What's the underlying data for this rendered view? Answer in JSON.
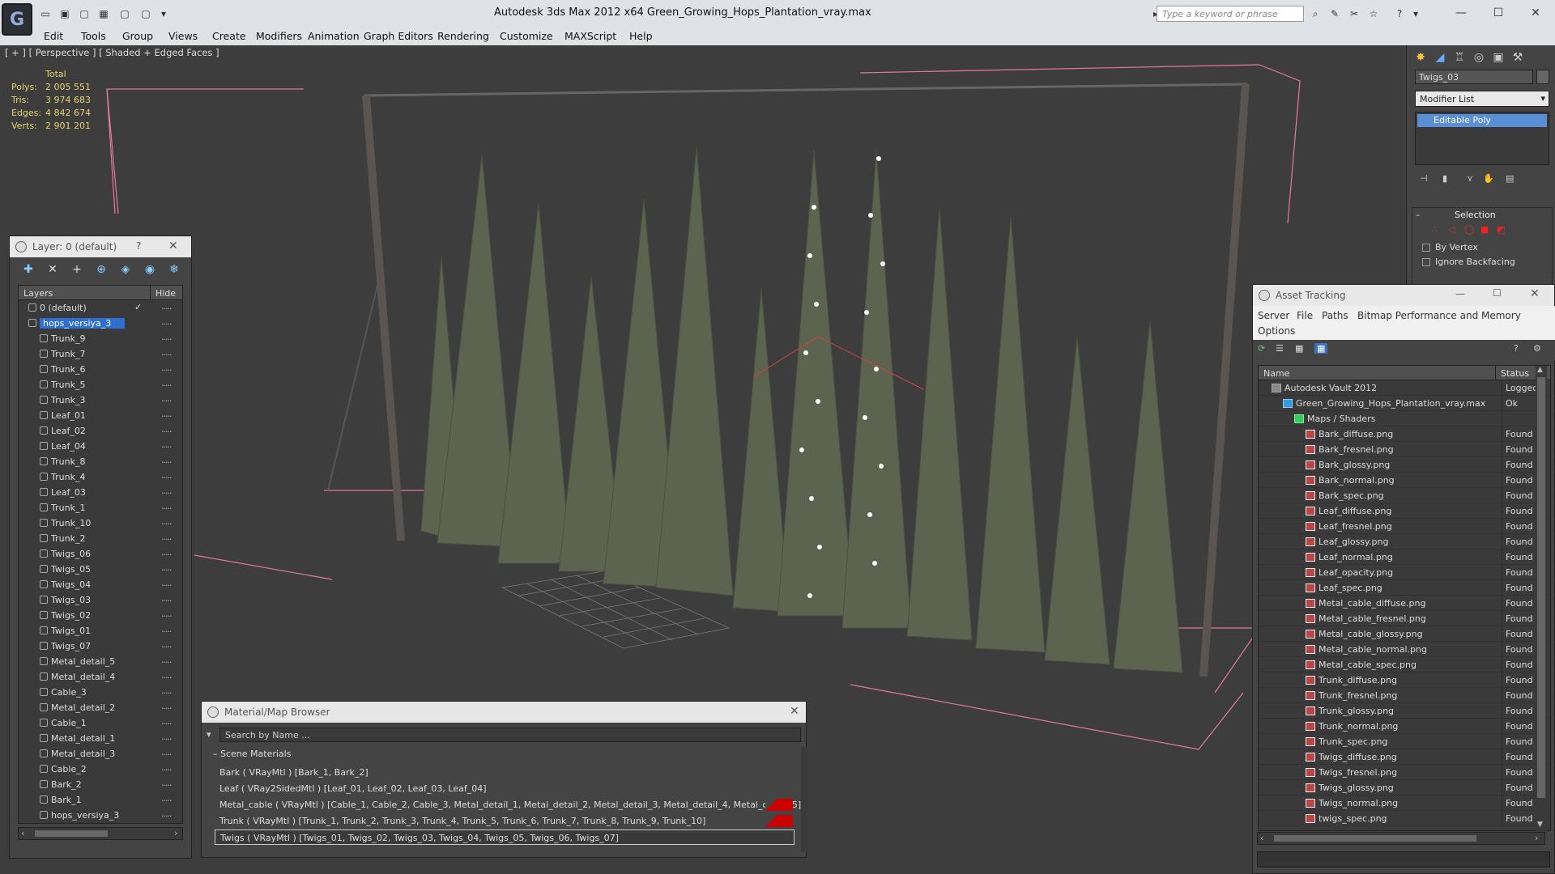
{
  "window": {
    "title": "Autodesk 3ds Max  2012 x64      Green_Growing_Hops_Plantation_vray.max",
    "search_placeholder": "Type a keyword or phrase"
  },
  "menu": [
    "Edit",
    "Tools",
    "Group",
    "Views",
    "Create",
    "Modifiers",
    "Animation",
    "Graph Editors",
    "Rendering",
    "Customize",
    "MAXScript",
    "Help"
  ],
  "viewport": {
    "label": "[ + ] [ Perspective ] [ Shaded + Edged Faces ]",
    "stats": {
      "header": "Total",
      "rows": [
        {
          "k": "Polys:",
          "v": "2 005 551"
        },
        {
          "k": "Tris:",
          "v": "3 974 683"
        },
        {
          "k": "Edges:",
          "v": "4 842 674"
        },
        {
          "k": "Verts:",
          "v": "2 901 201"
        }
      ]
    }
  },
  "layer_window": {
    "title": "Layer: 0 (default)",
    "help": "?",
    "col_layers": "Layers",
    "col_hide": "Hide",
    "layers": [
      {
        "name": "0 (default)",
        "level": 0,
        "check": true
      },
      {
        "name": "hops_versiya_3",
        "level": 0,
        "selected": true
      },
      {
        "name": "Trunk_9",
        "level": 1
      },
      {
        "name": "Trunk_7",
        "level": 1
      },
      {
        "name": "Trunk_6",
        "level": 1
      },
      {
        "name": "Trunk_5",
        "level": 1
      },
      {
        "name": "Trunk_3",
        "level": 1
      },
      {
        "name": "Leaf_01",
        "level": 1
      },
      {
        "name": "Leaf_02",
        "level": 1
      },
      {
        "name": "Leaf_04",
        "level": 1
      },
      {
        "name": "Trunk_8",
        "level": 1
      },
      {
        "name": "Trunk_4",
        "level": 1
      },
      {
        "name": "Leaf_03",
        "level": 1
      },
      {
        "name": "Trunk_1",
        "level": 1
      },
      {
        "name": "Trunk_10",
        "level": 1
      },
      {
        "name": "Trunk_2",
        "level": 1
      },
      {
        "name": "Twigs_06",
        "level": 1
      },
      {
        "name": "Twigs_05",
        "level": 1
      },
      {
        "name": "Twigs_04",
        "level": 1
      },
      {
        "name": "Twigs_03",
        "level": 1
      },
      {
        "name": "Twigs_02",
        "level": 1
      },
      {
        "name": "Twigs_01",
        "level": 1
      },
      {
        "name": "Twigs_07",
        "level": 1
      },
      {
        "name": "Metal_detail_5",
        "level": 1
      },
      {
        "name": "Metal_detail_4",
        "level": 1
      },
      {
        "name": "Cable_3",
        "level": 1
      },
      {
        "name": "Metal_detail_2",
        "level": 1
      },
      {
        "name": "Cable_1",
        "level": 1
      },
      {
        "name": "Metal_detail_1",
        "level": 1
      },
      {
        "name": "Metal_detail_3",
        "level": 1
      },
      {
        "name": "Cable_2",
        "level": 1
      },
      {
        "name": "Bark_2",
        "level": 1
      },
      {
        "name": "Bark_1",
        "level": 1
      },
      {
        "name": "hops_versiya_3",
        "level": 1
      }
    ]
  },
  "command_panel": {
    "object_name": "Twigs_03",
    "modifier_list": "Modifier List",
    "modifier_stack": [
      "Editable Poly"
    ],
    "selection_title": "Selection",
    "by_vertex": "By Vertex",
    "ignore_backfacing": "Ignore Backfacing"
  },
  "asset_tracking": {
    "title": "Asset Tracking",
    "menu": [
      "Server",
      "File",
      "Paths",
      "Bitmap Performance and Memory",
      "Options"
    ],
    "col_name": "Name",
    "col_status": "Status",
    "rows": [
      {
        "name": "Autodesk Vault 2012",
        "status": "Logged",
        "level": 0,
        "kind": "vault"
      },
      {
        "name": "Green_Growing_Hops_Plantation_vray.max",
        "status": "Ok",
        "level": 1,
        "kind": "max"
      },
      {
        "name": "Maps / Shaders",
        "status": "",
        "level": 2,
        "kind": "folder"
      },
      {
        "name": "Bark_diffuse.png",
        "status": "Found",
        "level": 3,
        "kind": "png"
      },
      {
        "name": "Bark_fresnel.png",
        "status": "Found",
        "level": 3,
        "kind": "png"
      },
      {
        "name": "Bark_glossy.png",
        "status": "Found",
        "level": 3,
        "kind": "png"
      },
      {
        "name": "Bark_normal.png",
        "status": "Found",
        "level": 3,
        "kind": "png"
      },
      {
        "name": "Bark_spec.png",
        "status": "Found",
        "level": 3,
        "kind": "png"
      },
      {
        "name": "Leaf_diffuse.png",
        "status": "Found",
        "level": 3,
        "kind": "png"
      },
      {
        "name": "Leaf_fresnel.png",
        "status": "Found",
        "level": 3,
        "kind": "png"
      },
      {
        "name": "Leaf_glossy.png",
        "status": "Found",
        "level": 3,
        "kind": "png"
      },
      {
        "name": "Leaf_normal.png",
        "status": "Found",
        "level": 3,
        "kind": "png"
      },
      {
        "name": "Leaf_opacity.png",
        "status": "Found",
        "level": 3,
        "kind": "png"
      },
      {
        "name": "Leaf_spec.png",
        "status": "Found",
        "level": 3,
        "kind": "png"
      },
      {
        "name": "Metal_cable_diffuse.png",
        "status": "Found",
        "level": 3,
        "kind": "png"
      },
      {
        "name": "Metal_cable_fresnel.png",
        "status": "Found",
        "level": 3,
        "kind": "png"
      },
      {
        "name": "Metal_cable_glossy.png",
        "status": "Found",
        "level": 3,
        "kind": "png"
      },
      {
        "name": "Metal_cable_normal.png",
        "status": "Found",
        "level": 3,
        "kind": "png"
      },
      {
        "name": "Metal_cable_spec.png",
        "status": "Found",
        "level": 3,
        "kind": "png"
      },
      {
        "name": "Trunk_diffuse.png",
        "status": "Found",
        "level": 3,
        "kind": "png"
      },
      {
        "name": "Trunk_fresnel.png",
        "status": "Found",
        "level": 3,
        "kind": "png"
      },
      {
        "name": "Trunk_glossy.png",
        "status": "Found",
        "level": 3,
        "kind": "png"
      },
      {
        "name": "Trunk_normal.png",
        "status": "Found",
        "level": 3,
        "kind": "png"
      },
      {
        "name": "Trunk_spec.png",
        "status": "Found",
        "level": 3,
        "kind": "png"
      },
      {
        "name": "Twigs_diffuse.png",
        "status": "Found",
        "level": 3,
        "kind": "png"
      },
      {
        "name": "Twigs_fresnel.png",
        "status": "Found",
        "level": 3,
        "kind": "png"
      },
      {
        "name": "Twigs_glossy.png",
        "status": "Found",
        "level": 3,
        "kind": "png"
      },
      {
        "name": "Twigs_normal.png",
        "status": "Found",
        "level": 3,
        "kind": "png"
      },
      {
        "name": "twigs_spec.png",
        "status": "Found",
        "level": 3,
        "kind": "png"
      }
    ]
  },
  "material_browser": {
    "title": "Material/Map Browser",
    "search_placeholder": "Search by Name ...",
    "section": "Scene Materials",
    "materials": [
      {
        "text": "Bark  ( VRayMtl )  [Bark_1, Bark_2]",
        "warn": false
      },
      {
        "text": "Leaf  ( VRay2SidedMtl )  [Leaf_01, Leaf_02, Leaf_03, Leaf_04]",
        "warn": false
      },
      {
        "text": "Metal_cable  ( VRayMtl )  [Cable_1, Cable_2, Cable_3, Metal_detail_1, Metal_detail_2, Metal_detail_3, Metal_detail_4, Metal_detail_5]",
        "warn": true
      },
      {
        "text": "Trunk  ( VRayMtl )  [Trunk_1, Trunk_2, Trunk_3, Trunk_4, Trunk_5, Trunk_6, Trunk_7, Trunk_8, Trunk_9, Trunk_10]",
        "warn": true
      },
      {
        "text": "Twigs  ( VRayMtl )  [Twigs_01, Twigs_02, Twigs_03, Twigs_04, Twigs_05, Twigs_06, Twigs_07]",
        "warn": false,
        "active": true
      }
    ]
  }
}
